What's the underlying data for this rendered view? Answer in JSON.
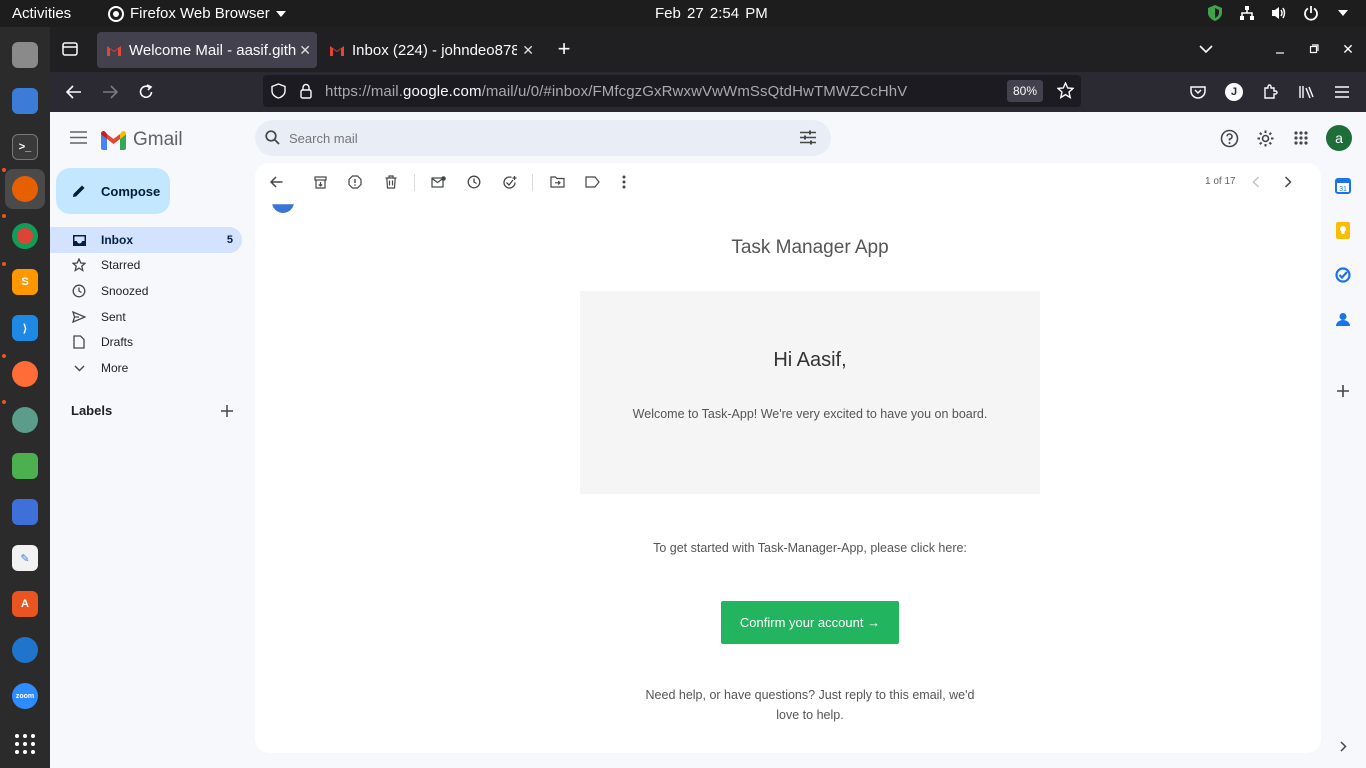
{
  "system": {
    "activities": "Activities",
    "app_menu": "Firefox Web Browser",
    "clock": "Feb 27  2:54 PM"
  },
  "browser": {
    "tabs": [
      {
        "title": "Welcome Mail - aasif.gith",
        "active": true
      },
      {
        "title": "Inbox (224) - johndeo878",
        "active": false
      }
    ],
    "url_prefix": "https://mail.",
    "url_domain": "google.com",
    "url_path": "/mail/u/0/#inbox/FMfcgzGxRwxwVwWmSsQtdHwTMWZCcHhV",
    "zoom": "80%",
    "profile_initial": "J"
  },
  "gmail": {
    "logo_text": "Gmail",
    "search_placeholder": "Search mail",
    "account_initial": "a",
    "compose_label": "Compose",
    "nav": [
      {
        "label": "Inbox",
        "count": "5"
      },
      {
        "label": "Starred",
        "count": ""
      },
      {
        "label": "Snoozed",
        "count": ""
      },
      {
        "label": "Sent",
        "count": ""
      },
      {
        "label": "Drafts",
        "count": ""
      },
      {
        "label": "More",
        "count": ""
      }
    ],
    "labels_title": "Labels",
    "pagination": "1 of 17"
  },
  "email": {
    "header": "Task Manager App",
    "greeting": "Hi Aasif,",
    "welcome_text": "Welcome to Task-App! We're very excited to have you on board.",
    "get_started": "To get started with Task-Manager-App, please click here:",
    "confirm_button": "Confirm your account →",
    "help_text": "Need help, or have questions? Just reply to this email, we'd love to help."
  },
  "colors": {
    "accent_confirm": "#22b45e",
    "gmail_compose": "#c2e7ff",
    "inbox_selected": "#d3e3fd"
  },
  "icons": [
    "shield-icon",
    "network-icon",
    "volume-icon",
    "power-icon",
    "search-icon",
    "filter-icon",
    "help-icon",
    "settings-icon",
    "apps-icon",
    "back-arrow-icon",
    "archive-icon",
    "report-spam-icon",
    "delete-icon",
    "mark-unread-icon",
    "snooze-icon",
    "add-task-icon",
    "move-to-icon",
    "label-icon",
    "more-vert-icon"
  ]
}
